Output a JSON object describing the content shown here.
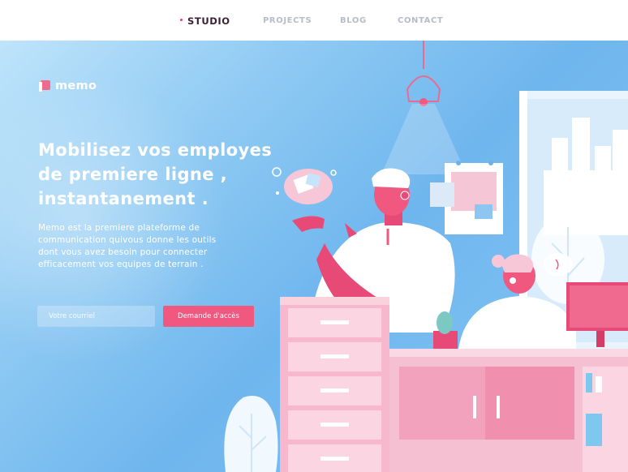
{
  "nav": {
    "items": [
      {
        "label": "STUDIO",
        "active": true
      },
      {
        "label": "PROJECTS",
        "active": false
      },
      {
        "label": "BLOG",
        "active": false
      },
      {
        "label": "CONTACT",
        "active": false
      }
    ]
  },
  "brand": {
    "name": "memo",
    "accent": "#f06a90"
  },
  "hero": {
    "headline_lines": [
      "Mobilisez vos employes",
      "de premiere ligne ,",
      "instantanement ."
    ],
    "description_lines": [
      "Memo est la premiere plateforme de",
      "communication quivous donne les outils",
      "dont vous avez besoin pour connecter",
      "efficacement vos equipes de terrain ."
    ],
    "email_placeholder": "Votre courriel",
    "cta_label": "Demande d'accès"
  },
  "colors": {
    "pink": "#f0587f",
    "sky": "#7cc0f2",
    "nav_active": "#3a1f35",
    "nav_inactive": "#b6bcc8"
  }
}
